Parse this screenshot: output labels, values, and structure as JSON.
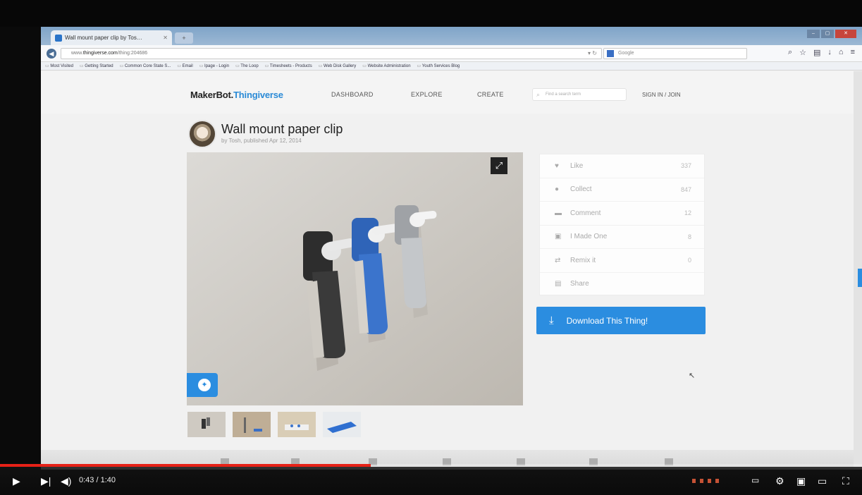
{
  "browser": {
    "tab_title": "Wall mount paper clip by Tos…",
    "new_tab_label": "+",
    "url_prefix": "www.",
    "url_domain": "thingiverse.com",
    "url_path": "/thing:204686",
    "search_engine_placeholder": "Google",
    "bookmarks": [
      "Most Visited",
      "Getting Started",
      "Common Core State S...",
      "Email",
      "Ipage - Login",
      "The Loop",
      "Timesheets - Products",
      "Web Disk Gallery",
      "Website Administration",
      "Youth Services Blog"
    ]
  },
  "site": {
    "logo_main": "MakerBot.",
    "logo_accent": "Thingiverse",
    "nav": {
      "dashboard": "DASHBOARD",
      "explore": "EXPLORE",
      "create": "CREATE"
    },
    "search_placeholder": "Find a search term",
    "signin": "SIGN IN / JOIN"
  },
  "thing": {
    "title": "Wall mount paper clip",
    "byline": "by Tosh, published Apr 12, 2014"
  },
  "stats": [
    {
      "icon": "heart-icon",
      "glyph": "♥",
      "label": "Like",
      "count": "337"
    },
    {
      "icon": "collect-icon",
      "glyph": "●",
      "label": "Collect",
      "count": "847"
    },
    {
      "icon": "comment-icon",
      "glyph": "▬",
      "label": "Comment",
      "count": "12"
    },
    {
      "icon": "made-icon",
      "glyph": "▣",
      "label": "I Made One",
      "count": "8"
    },
    {
      "icon": "remix-icon",
      "glyph": "⇄",
      "label": "Remix it",
      "count": "0"
    },
    {
      "icon": "share-icon",
      "glyph": "▤",
      "label": "Share",
      "count": ""
    }
  ],
  "download_label": "Download This Thing!",
  "player": {
    "time": "0:43 / 1:40",
    "progress_fraction": 0.43,
    "accent": "#e62117"
  },
  "colors": {
    "brand_blue": "#2b8de0"
  }
}
